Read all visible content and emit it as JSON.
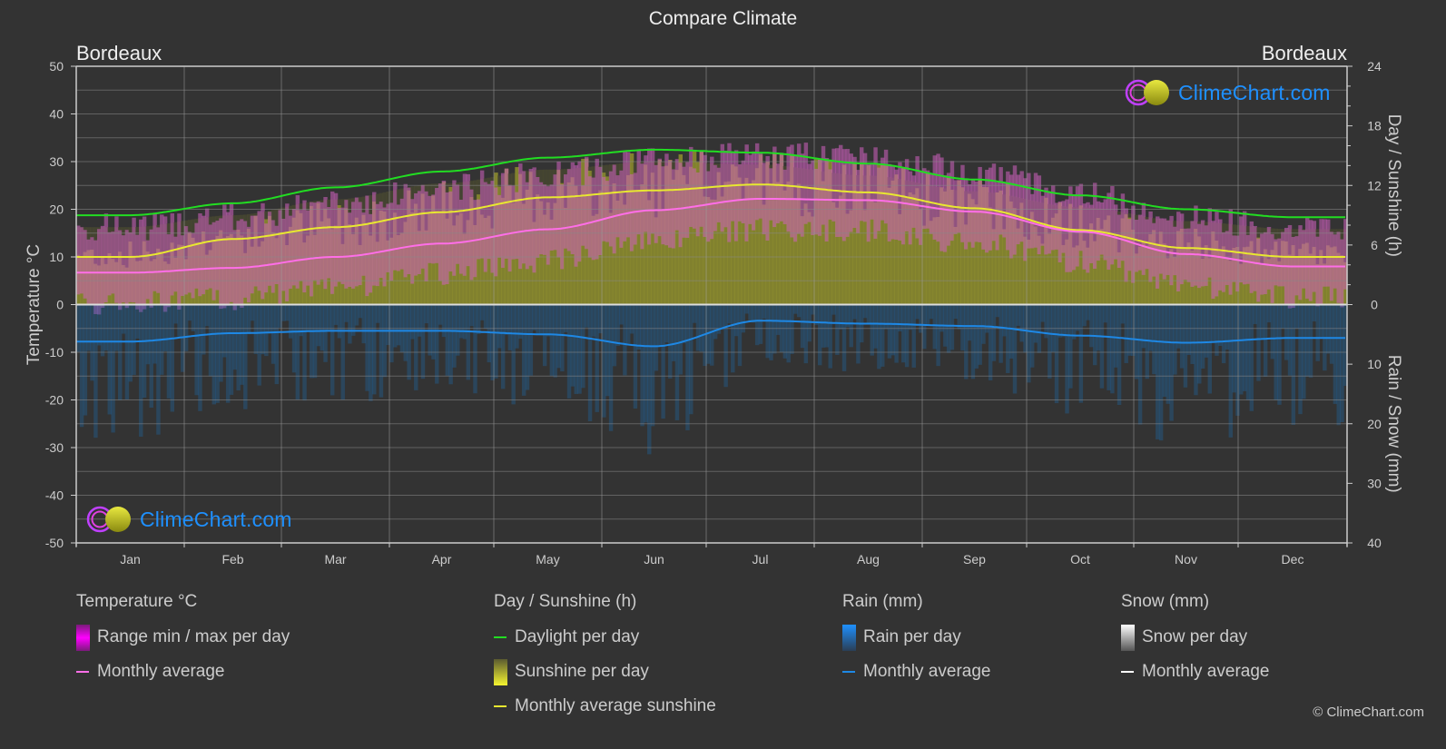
{
  "header": {
    "title": "Compare Climate",
    "city_left": "Bordeaux",
    "city_right": "Bordeaux"
  },
  "logo": {
    "text": "ClimeChart.com"
  },
  "copyright": "© ClimeChart.com",
  "legend": {
    "temperature": {
      "heading": "Temperature °C",
      "items": [
        {
          "label": "Range min / max per day",
          "kind": "box",
          "color": "#e020e0"
        },
        {
          "label": "Monthly average",
          "kind": "line",
          "color": "#ff6ee8"
        }
      ]
    },
    "sunshine": {
      "heading": "Day / Sunshine (h)",
      "items": [
        {
          "label": "Daylight per day",
          "kind": "line",
          "color": "#22dd22"
        },
        {
          "label": "Sunshine per day",
          "kind": "box",
          "color": "#e8e830"
        },
        {
          "label": "Monthly average sunshine",
          "kind": "line",
          "color": "#e8e830"
        }
      ]
    },
    "rain": {
      "heading": "Rain (mm)",
      "items": [
        {
          "label": "Rain per day",
          "kind": "box",
          "color": "#1e88e5"
        },
        {
          "label": "Monthly average",
          "kind": "line",
          "color": "#1e88e5"
        }
      ]
    },
    "snow": {
      "heading": "Snow (mm)",
      "items": [
        {
          "label": "Snow per day",
          "kind": "box",
          "color": "#dddddd"
        },
        {
          "label": "Monthly average",
          "kind": "line",
          "color": "#ffffff"
        }
      ]
    }
  },
  "chart_data": {
    "type": "line",
    "title": "Compare Climate",
    "location": "Bordeaux",
    "categories": [
      "Jan",
      "Feb",
      "Mar",
      "Apr",
      "May",
      "Jun",
      "Jul",
      "Aug",
      "Sep",
      "Oct",
      "Nov",
      "Dec"
    ],
    "axes": {
      "left": {
        "label": "Temperature °C",
        "range": [
          -50,
          50
        ],
        "ticks": [
          50,
          40,
          30,
          20,
          10,
          0,
          -10,
          -20,
          -30,
          -40,
          -50
        ]
      },
      "right_top": {
        "label": "Day / Sunshine (h)",
        "range": [
          0,
          24
        ],
        "ticks": [
          24,
          18,
          12,
          6,
          0
        ]
      },
      "right_bottom": {
        "label": "Rain / Snow (mm)",
        "range": [
          0,
          40
        ],
        "ticks": [
          0,
          10,
          20,
          30,
          40
        ]
      }
    },
    "grid": true,
    "series": [
      {
        "name": "Temperature monthly average (°C)",
        "axis": "left",
        "color": "#ff6ee8",
        "values": [
          6.7,
          7.7,
          10.0,
          12.8,
          15.8,
          19.8,
          22.2,
          21.9,
          19.5,
          15.3,
          10.6,
          8.0
        ]
      },
      {
        "name": "Temperature range max per day (°C, approx monthly upper envelope)",
        "axis": "left",
        "color": "#e020e0",
        "values": [
          15,
          17,
          20,
          23,
          26,
          29,
          30,
          30,
          27,
          22,
          17,
          15
        ]
      },
      {
        "name": "Daylight per day (h)",
        "axis": "right_top",
        "color": "#22dd22",
        "values": [
          9.0,
          10.2,
          11.8,
          13.4,
          14.8,
          15.6,
          15.3,
          14.2,
          12.6,
          11.0,
          9.6,
          8.8
        ]
      },
      {
        "name": "Monthly average sunshine (h)",
        "axis": "right_top",
        "color": "#e8e830",
        "values": [
          4.8,
          6.6,
          7.8,
          9.3,
          10.8,
          11.5,
          12.1,
          11.3,
          9.7,
          7.5,
          5.7,
          4.8
        ]
      },
      {
        "name": "Rain monthly average (mm)",
        "axis": "right_bottom",
        "color": "#1e88e5",
        "values": [
          6.2,
          4.8,
          4.4,
          4.4,
          5.0,
          7.0,
          2.7,
          3.2,
          3.6,
          5.2,
          6.4,
          5.6
        ]
      },
      {
        "name": "Snow monthly average (mm)",
        "axis": "right_bottom",
        "color": "#ffffff",
        "values": [
          0,
          0,
          0,
          0,
          0,
          0,
          0,
          0,
          0,
          0,
          0,
          0
        ]
      }
    ]
  }
}
